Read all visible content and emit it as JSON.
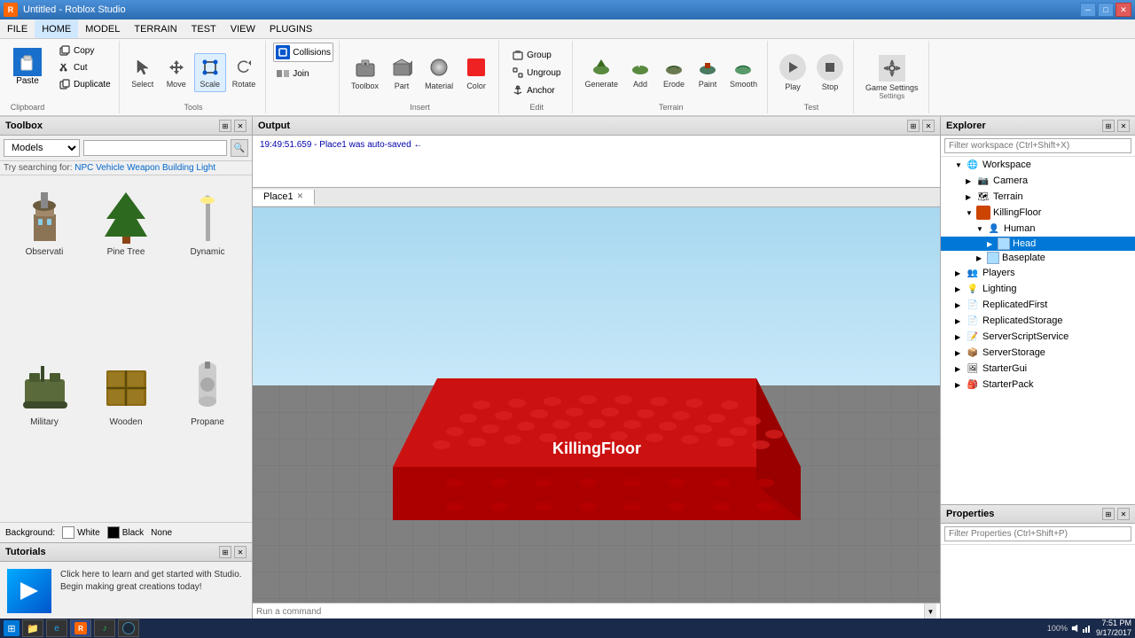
{
  "titlebar": {
    "icon": "R",
    "title": "Untitled - Roblox Studio",
    "controls": [
      "minimize",
      "maximize",
      "close"
    ]
  },
  "menubar": {
    "items": [
      "FILE",
      "HOME",
      "MODEL",
      "TERRAIN",
      "TEST",
      "VIEW",
      "PLUGINS"
    ]
  },
  "ribbon": {
    "clipboard": {
      "paste_label": "Paste",
      "copy_label": "Copy",
      "cut_label": "Cut",
      "duplicate_label": "Duplicate",
      "section_label": "Clipboard"
    },
    "tools": {
      "select_label": "Select",
      "move_label": "Move",
      "scale_label": "Scale",
      "rotate_label": "Rotate",
      "section_label": "Tools"
    },
    "toolbox_btn": "Toolbox",
    "part_btn": "Part",
    "material_btn": "Material",
    "color_btn": "Color",
    "insert_label": "Insert",
    "group_label": "Group",
    "ungroup_label": "Ungroup",
    "anchor_label": "Anchor",
    "edit_label": "Edit",
    "collisions_label": "Collisions",
    "join_label": "Join",
    "generate_label": "Generate",
    "add_label": "Add",
    "erode_label": "Erode",
    "paint_label": "Paint",
    "smooth_label": "Smooth",
    "terrain_label": "Terrain",
    "play_label": "Play",
    "stop_label": "Stop",
    "test_label": "Test",
    "game_settings_label": "Game Settings",
    "settings_label": "Settings"
  },
  "toolbox": {
    "title": "Toolbox",
    "dropdown_value": "Models",
    "search_placeholder": "",
    "try_label": "Try searching for:",
    "categories": [
      "NPC",
      "Vehicle",
      "Weapon",
      "Building",
      "Light"
    ],
    "models": [
      {
        "name": "Observati",
        "label": "Observati"
      },
      {
        "name": "Pine Tree",
        "label": "Pine Tree"
      },
      {
        "name": "Dynamic",
        "label": "Dynamic"
      },
      {
        "name": "Military",
        "label": "Military"
      },
      {
        "name": "Wooden",
        "label": "Wooden"
      },
      {
        "name": "Propane",
        "label": "Propane"
      }
    ],
    "background_label": "Background:",
    "bg_options": [
      {
        "label": "White",
        "color": "#ffffff"
      },
      {
        "label": "Black",
        "color": "#000000"
      },
      {
        "label": "None",
        "color": "transparent"
      }
    ]
  },
  "tutorials": {
    "title": "Tutorials",
    "text": "Click here to learn and get started with Studio. Begin making great creations today!"
  },
  "output": {
    "title": "Output",
    "message": "19:49:51.659 - Place1 was auto-saved ←"
  },
  "viewport": {
    "tab_label": "Place1",
    "scene_label": "KillingFloor"
  },
  "command_bar": {
    "placeholder": "Run a command"
  },
  "explorer": {
    "title": "Explorer",
    "filter_placeholder": "Filter workspace (Ctrl+Shift+X)",
    "tree": [
      {
        "id": "workspace",
        "label": "Workspace",
        "depth": 0,
        "expanded": true,
        "icon": "🌐"
      },
      {
        "id": "camera",
        "label": "Camera",
        "depth": 1,
        "expanded": false,
        "icon": "📷"
      },
      {
        "id": "terrain",
        "label": "Terrain",
        "depth": 1,
        "expanded": false,
        "icon": "🗺"
      },
      {
        "id": "killingfloor",
        "label": "KillingFloor",
        "depth": 1,
        "expanded": true,
        "icon": "🔧"
      },
      {
        "id": "human",
        "label": "Human",
        "depth": 2,
        "expanded": false,
        "icon": "👤"
      },
      {
        "id": "head",
        "label": "Head",
        "depth": 3,
        "expanded": false,
        "icon": "⬜",
        "selected": true
      },
      {
        "id": "baseplate",
        "label": "Baseplate",
        "depth": 2,
        "expanded": false,
        "icon": "⬜"
      },
      {
        "id": "players",
        "label": "Players",
        "depth": 0,
        "expanded": false,
        "icon": "👥"
      },
      {
        "id": "lighting",
        "label": "Lighting",
        "depth": 0,
        "expanded": false,
        "icon": "💡"
      },
      {
        "id": "replicatedfirst",
        "label": "ReplicatedFirst",
        "depth": 0,
        "expanded": false,
        "icon": "📁"
      },
      {
        "id": "replicatedstorage",
        "label": "ReplicatedStorage",
        "depth": 0,
        "expanded": false,
        "icon": "📁"
      },
      {
        "id": "serverscriptservice",
        "label": "ServerScriptService",
        "depth": 0,
        "expanded": false,
        "icon": "📝"
      },
      {
        "id": "serverstorage",
        "label": "ServerStorage",
        "depth": 0,
        "expanded": false,
        "icon": "📁"
      },
      {
        "id": "starterGui",
        "label": "StarterGui",
        "depth": 0,
        "expanded": false,
        "icon": "🖼"
      },
      {
        "id": "starterpack",
        "label": "StarterPack",
        "depth": 0,
        "expanded": false,
        "icon": "🎒"
      }
    ]
  },
  "properties": {
    "title": "Properties",
    "filter_placeholder": "Filter Properties (Ctrl+Shift+P)"
  },
  "taskbar": {
    "time": "7:51 PM",
    "date": "9/17/2017",
    "zoom": "100%"
  }
}
